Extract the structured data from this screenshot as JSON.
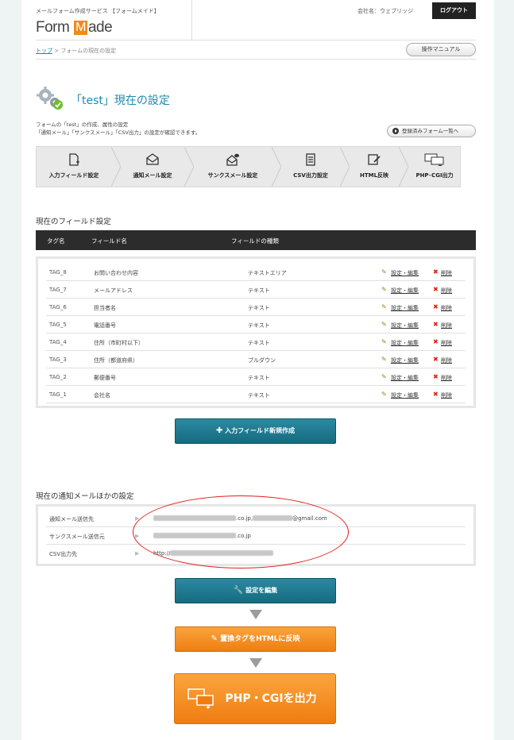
{
  "header": {
    "service_name": "メールフォーム作成サービス 【フォームメイド】",
    "logo_pre": "Form ",
    "logo_m": "M",
    "logo_post": "ade",
    "company": "会社名：ウェブリッジ",
    "logout_label": "ログアウト"
  },
  "breadcrumb": {
    "top_link": "トップ",
    "separator": " > ",
    "current": "フォームの現在の設定"
  },
  "manual_label": "操作マニュアル",
  "title": "「test」現在の設定",
  "description": [
    "フォームの「test」の作成、属性の設定",
    "「通知メール」「サンクスメール」「CSV出力」の設定が確認できます。"
  ],
  "forms_list_label": "登録済みフォーム一覧へ",
  "steps": [
    {
      "label": "入力フィールド設定",
      "icon": "doc-plus-icon"
    },
    {
      "label": "通知メール設定",
      "icon": "envelope-icon"
    },
    {
      "label": "サンクスメール設定",
      "icon": "envelope-bubble-icon"
    },
    {
      "label": "CSV出力設定",
      "icon": "csv-doc-icon"
    },
    {
      "label": "HTML反映",
      "icon": "html-edit-icon"
    },
    {
      "label": "PHP･CGI出力",
      "icon": "php-cgi-icon"
    }
  ],
  "fields_section_title": "現在のフィールド設定",
  "fields_header": {
    "tag": "タグ名",
    "name": "フィールド名",
    "type": "フィールドの種類"
  },
  "fields": [
    {
      "tag": "TAG_8",
      "name": "お問い合わせ内容",
      "type": "テキストエリア"
    },
    {
      "tag": "TAG_7",
      "name": "メールアドレス",
      "type": "テキスト"
    },
    {
      "tag": "TAG_6",
      "name": "担当者名",
      "type": "テキスト"
    },
    {
      "tag": "TAG_5",
      "name": "電話番号",
      "type": "テキスト"
    },
    {
      "tag": "TAG_4",
      "name": "住所（市町村以下）",
      "type": "テキスト"
    },
    {
      "tag": "TAG_3",
      "name": "住所（都道府県）",
      "type": "プルダウン"
    },
    {
      "tag": "TAG_2",
      "name": "郵便番号",
      "type": "テキスト"
    },
    {
      "tag": "TAG_1",
      "name": "会社名",
      "type": "テキスト"
    }
  ],
  "row_actions": {
    "edit": "設定・編集",
    "delete": "削除"
  },
  "new_field_label": "入力フィールド新規作成",
  "notify_section_title": "現在の通知メールほかの設定",
  "notify_rows": [
    {
      "label": "通知メール送信先",
      "value": ".co.jp,",
      "value2": "@gmail.com"
    },
    {
      "label": "サンクスメール送信元",
      "value": ".co.jp",
      "value2": ""
    },
    {
      "label": "CSV出力先",
      "value": "http://",
      "value2": ""
    }
  ],
  "edit_settings_label": "設定を編集",
  "html_reflect_label": "置換タグをHTMLに反映",
  "php_cgi_label": "PHP・CGIを出力",
  "colors": {
    "accent": "#1a8ab0",
    "teal_button": "#156b80",
    "orange_button": "#ef7e12",
    "annotation": "#e21b1b"
  }
}
